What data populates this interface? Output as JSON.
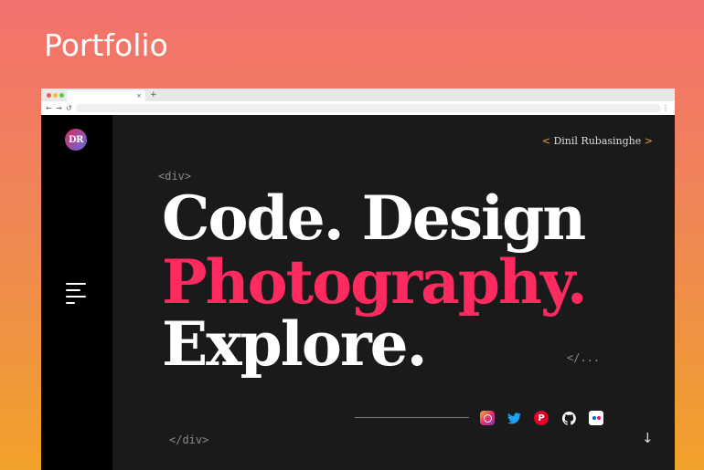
{
  "page": {
    "title": "Portfolio"
  },
  "browser": {
    "new_tab": "+",
    "tab_close": "×",
    "nav": {
      "back": "←",
      "forward": "→",
      "reload": "↺",
      "menu": "⋮"
    }
  },
  "site": {
    "logo": "DR",
    "author": {
      "open": "<",
      "name": "Dinil Rubasinghe",
      "close": ">"
    },
    "tags": {
      "open": "<div>",
      "close": "</div>",
      "ellipsis": "</..."
    },
    "headline": {
      "line1": "Code. Design",
      "line2": "Photography.",
      "line3": "Explore."
    },
    "social_icons": [
      "instagram-icon",
      "twitter-icon",
      "pinterest-icon",
      "github-icon",
      "flickr-icon"
    ],
    "colors": {
      "accent": "#ff2a5f",
      "bracket": "#e9a83a",
      "background": "#1a1a1a",
      "sidebar": "#000000"
    },
    "scroll_arrow": "↓"
  }
}
